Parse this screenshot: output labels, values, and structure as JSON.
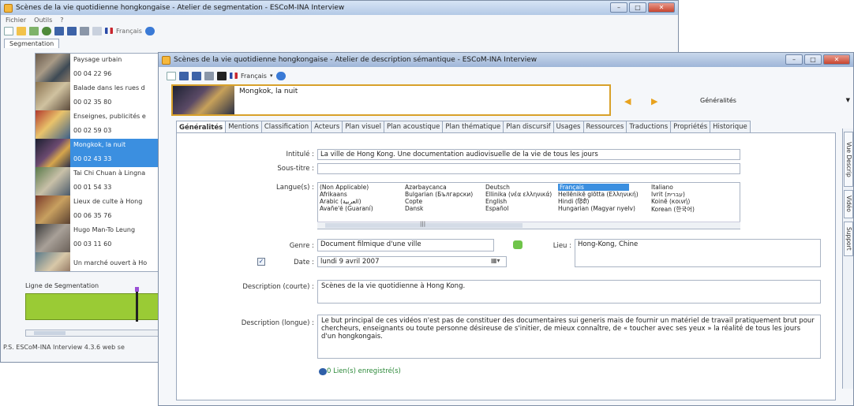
{
  "back_window": {
    "title": "Scènes de la vie quotidienne hongkongaise - Atelier de segmentation - ESCoM-INA Interview",
    "menu": [
      "Fichier",
      "Outils",
      "?"
    ],
    "toolbar_lang": "Français",
    "tab": "Segmentation",
    "segments": [
      {
        "title": "Paysage urbain",
        "time": "00 04 22 96"
      },
      {
        "title": "Balade dans les rues d",
        "time": "00 02 35 80"
      },
      {
        "title": "Enseignes, publicités e",
        "time": "00 02 59 03"
      },
      {
        "title": "Mongkok, la nuit",
        "time": "00 02 43 33"
      },
      {
        "title": "Tai Chi Chuan à Lingna",
        "time": "00 01 54 33"
      },
      {
        "title": "Lieux de culte à Hong",
        "time": "00 06 35 76"
      },
      {
        "title": "Hugo Man-To Leung",
        "time": "00 03 11 60"
      },
      {
        "title": "Un marché ouvert à Ho",
        "time": ""
      }
    ],
    "segmentation_line_label": "Ligne de Segmentation",
    "status": "P.S. ESCoM-INA Interview 4.3.6    web se"
  },
  "front_window": {
    "title": "Scènes de la vie quotidienne hongkongaise - Atelier de description sémantique - ESCoM-INA Interview",
    "toolbar_lang": "Français",
    "clip_title": "Mongkok, la nuit",
    "section_select": "Généralités",
    "tabs": [
      "Généralités",
      "Mentions",
      "Classification",
      "Acteurs",
      "Plan visuel",
      "Plan acoustique",
      "Plan thématique",
      "Plan discursif",
      "Usages",
      "Ressources",
      "Traductions",
      "Propriétés",
      "Historique"
    ],
    "side_tabs": [
      "Vue Descrip",
      "Vidéo",
      "Support"
    ],
    "fields": {
      "intitule_label": "Intitulé :",
      "intitule_value": "La ville de Hong Kong. Une documentation audiovisuelle de la vie de tous les jours",
      "soustitre_label": "Sous-titre :",
      "soustitre_value": "",
      "langue_label": "Langue(s) :",
      "genre_label": "Genre :",
      "genre_value": "Document filmique d'une ville",
      "lieu_label": "Lieu :",
      "lieu_value": "Hong-Kong, Chine",
      "date_label": "Date :",
      "date_value": "lundi    9    avril    2007",
      "desc_courte_label": "Description (courte) :",
      "desc_courte_value": "Scènes de la vie quotidienne à Hong Kong.",
      "desc_longue_label": "Description (longue) :",
      "desc_longue_value": "Le but principal de ces vidéos n'est pas de constituer des documentaires sui generis mais de fournir un matériel de travail pratiquement brut pour chercheurs, enseignants ou toute personne désireuse de s'initier, de mieux connaître, de « toucher avec ses yeux » la réalité de tous les jours d'un hongkongais.",
      "links": "0 Lien(s) enregistré(s)"
    },
    "languages": [
      [
        "(Non Applicable)",
        "Afrikaans",
        "Arabic (العربية)",
        "Avañe'ẽ (Guaraní)"
      ],
      [
        "Azərbaycanca",
        "Bulgarian (Български)",
        "Copte",
        "Dansk"
      ],
      [
        "Deutsch",
        "Ellinika (νέα ελληνικά)",
        "English",
        "Español"
      ],
      [
        "Français",
        "Hellēnikē glōtta (Ελληνική)",
        "Hindi (हिंदी)",
        "Hungarian (Magyar nyelv)"
      ],
      [
        "Italiano",
        "Ivrit (עברית)",
        "Koinē (κοινή)",
        "Korean (한국어)"
      ]
    ],
    "selected_language": "Français"
  }
}
